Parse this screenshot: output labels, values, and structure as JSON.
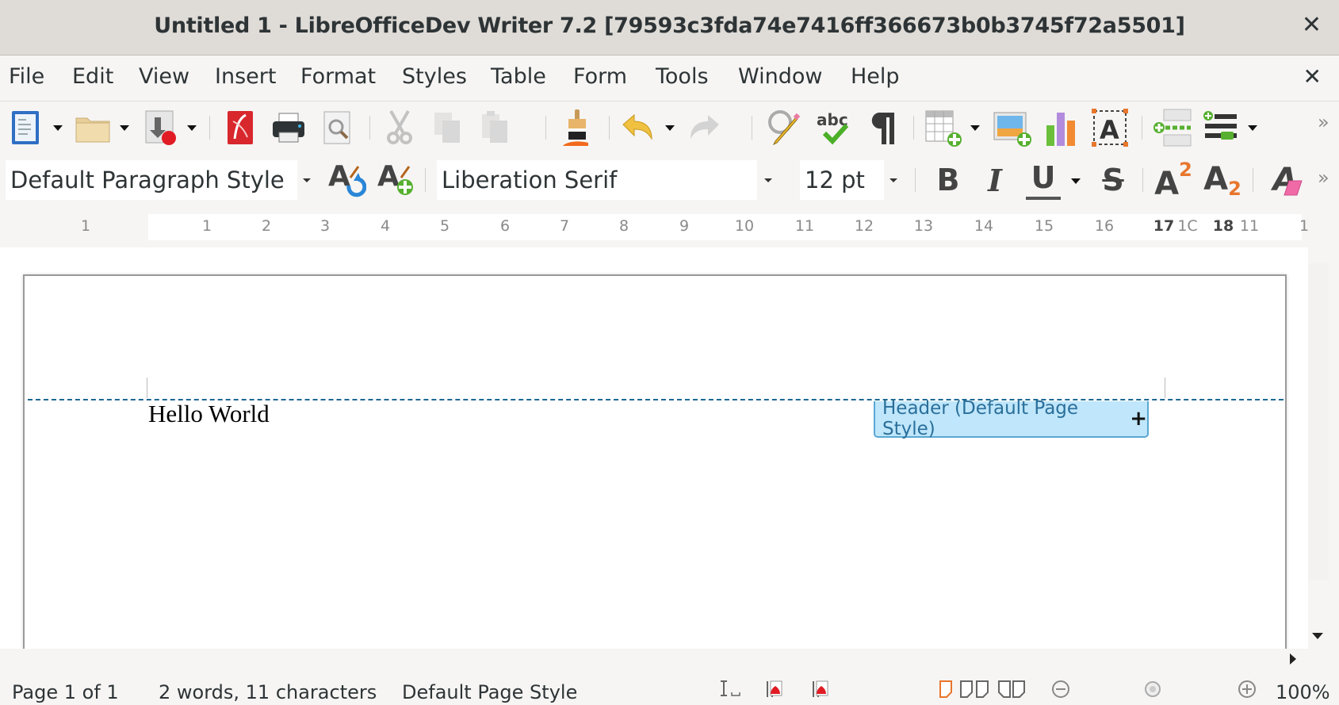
{
  "window": {
    "title": "Untitled 1 - LibreOfficeDev Writer 7.2 [79593c3fda74e7416ff366673b0b3745f72a5501]",
    "close_label": "✕"
  },
  "menubar": {
    "items": [
      "File",
      "Edit",
      "View",
      "Insert",
      "Format",
      "Styles",
      "Table",
      "Form",
      "Tools",
      "Window",
      "Help"
    ],
    "close_document_label": "✕"
  },
  "toolbar_standard": {
    "buttons": [
      {
        "name": "new-document",
        "icon": "new-document-icon",
        "has_dropdown": true
      },
      {
        "name": "open",
        "icon": "folder-icon",
        "has_dropdown": true
      },
      {
        "name": "save",
        "icon": "save-icon",
        "has_dropdown": true
      },
      {
        "name": "export-pdf",
        "icon": "pdf-icon"
      },
      {
        "name": "print",
        "icon": "printer-icon"
      },
      {
        "name": "print-preview",
        "icon": "print-preview-icon"
      },
      {
        "name": "cut",
        "icon": "scissors-icon",
        "disabled": true
      },
      {
        "name": "copy",
        "icon": "copy-icon",
        "disabled": true
      },
      {
        "name": "paste",
        "icon": "paste-icon",
        "disabled": true
      },
      {
        "name": "clone-formatting",
        "icon": "paintbrush-icon"
      },
      {
        "name": "undo",
        "icon": "undo-icon",
        "has_dropdown": true
      },
      {
        "name": "redo",
        "icon": "redo-icon",
        "disabled": true
      },
      {
        "name": "find-replace",
        "icon": "find-replace-icon"
      },
      {
        "name": "spelling",
        "icon": "spellcheck-icon"
      },
      {
        "name": "formatting-marks",
        "icon": "pilcrow-icon"
      },
      {
        "name": "insert-table",
        "icon": "table-icon",
        "has_dropdown": true
      },
      {
        "name": "insert-image",
        "icon": "image-icon"
      },
      {
        "name": "insert-chart",
        "icon": "chart-icon"
      },
      {
        "name": "insert-text-box",
        "icon": "text-box-icon"
      },
      {
        "name": "insert-page-break",
        "icon": "page-break-icon"
      },
      {
        "name": "insert-field",
        "icon": "field-icon",
        "has_dropdown": true
      }
    ],
    "overflow_label": "»"
  },
  "toolbar_formatting": {
    "paragraph_style": "Default Paragraph Style",
    "font_name": "Liberation Serif",
    "font_size": "12 pt",
    "bold_label": "B",
    "italic_label": "I",
    "underline_label": "U",
    "strikethrough_label": "S",
    "superscript_label": "A",
    "superscript_mark": "2",
    "subscript_label": "A",
    "subscript_mark": "2",
    "clear_formatting_label": "A",
    "overflow_label": "»"
  },
  "ruler": {
    "left_label": "1",
    "ticks": [
      "1",
      "2",
      "3",
      "4",
      "5",
      "6",
      "7",
      "8",
      "9",
      "10",
      "11",
      "12",
      "13",
      "14",
      "15",
      "16",
      "17",
      "1C",
      "18",
      "11",
      "1"
    ]
  },
  "document": {
    "text": "Hello World",
    "header_tag_label": "Header (Default Page Style)",
    "header_tag_plus": "+"
  },
  "statusbar": {
    "page": "Page 1 of 1",
    "word_count": "2 words, 11 characters",
    "page_style": "Default Page Style",
    "zoom": "100%"
  },
  "colors": {
    "header_line": "#1b6a93",
    "header_tag_bg": "#bfe6fb",
    "header_tag_text": "#2a6f9a",
    "accent_orange": "#e8762d"
  }
}
